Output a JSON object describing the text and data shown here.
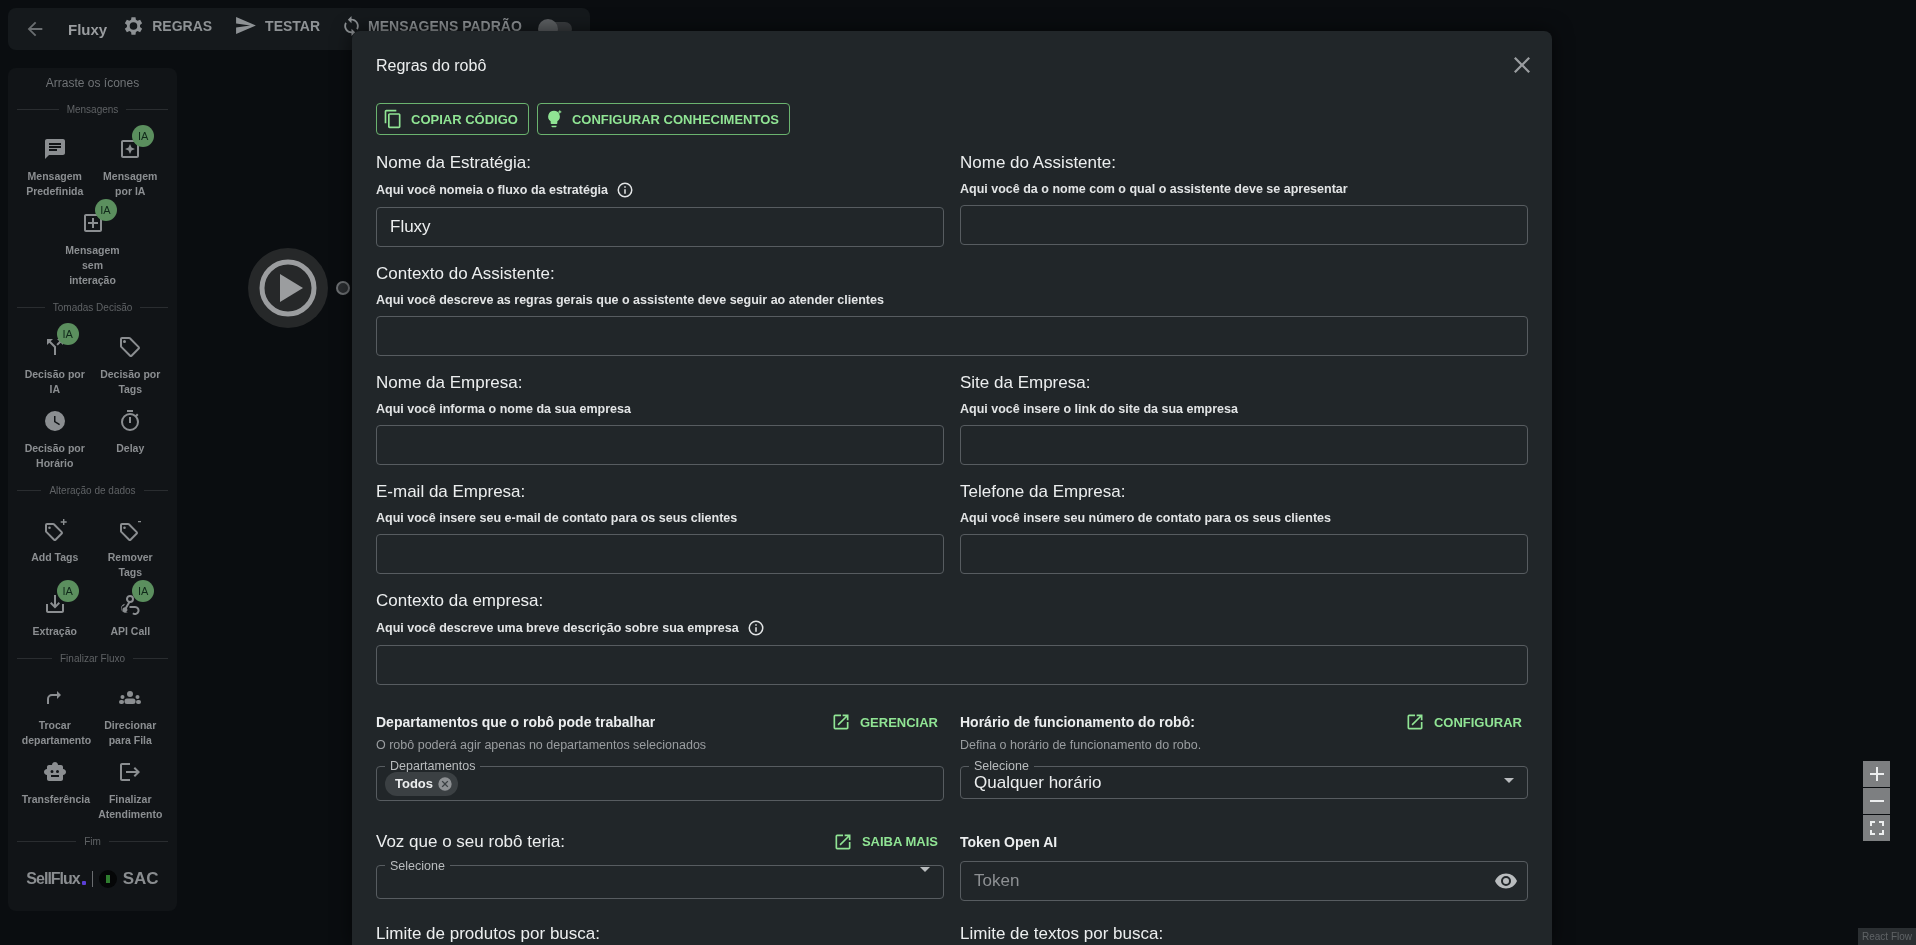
{
  "topbar": {
    "title": "Fluxy",
    "tabs": [
      {
        "label": "REGRAS"
      },
      {
        "label": "TESTAR"
      },
      {
        "label": "MENSAGENS PADRÃO"
      }
    ],
    "toggle": {
      "on": false
    }
  },
  "palette": {
    "title": "Arraste os ícones",
    "sections": [
      {
        "title": "Mensagens",
        "items": [
          {
            "label": "Mensagem Predefinida"
          },
          {
            "label": "Mensagem por IA",
            "badge": "IA"
          },
          {
            "label": "Mensagem sem interação",
            "badge": "IA"
          }
        ]
      },
      {
        "title": "Tomadas Decisão",
        "items": [
          {
            "label": "Decisão por IA",
            "badge": "IA"
          },
          {
            "label": "Decisão por Tags"
          },
          {
            "label": "Decisão por Horário"
          },
          {
            "label": "Delay"
          }
        ]
      },
      {
        "title": "Alteração de dados",
        "items": [
          {
            "label": "Add Tags"
          },
          {
            "label": "Remover Tags"
          },
          {
            "label": "Extração",
            "badge": "IA"
          },
          {
            "label": "API Call",
            "badge": "IA"
          }
        ]
      },
      {
        "title": "Finalizar Fluxo",
        "items": [
          {
            "label": "Trocar departamento"
          },
          {
            "label": "Direcionar para Fila"
          },
          {
            "label": "Transferência"
          },
          {
            "label": "Finalizar Atendimento"
          }
        ]
      },
      {
        "title": "Fim"
      }
    ],
    "logo": {
      "brand": "SellFlux",
      "product": "SAC"
    }
  },
  "canvas": {
    "attribution": "React Flow"
  },
  "dialog": {
    "title": "Regras do robô",
    "actions": [
      {
        "label": "COPIAR CÓDIGO"
      },
      {
        "label": "CONFIGURAR CONHECIMENTOS"
      }
    ],
    "rows": [
      [
        {
          "kind": "text",
          "label": "Nome da Estratégia:",
          "help": "Aqui você nomeia o fluxo da estratégia",
          "info": true,
          "value": "Fluxy"
        },
        {
          "kind": "text",
          "label": "Nome do Assistente:",
          "help": "Aqui você da o nome com o qual o assistente deve se apresentar",
          "info": false
        }
      ],
      [
        {
          "kind": "text",
          "label": "Contexto do Assistente:",
          "help": "Aqui você descreve as regras gerais que o assistente deve seguir ao atender clientes",
          "info": false
        }
      ],
      [
        {
          "kind": "text",
          "label": "Nome da Empresa:",
          "help": "Aqui você informa o nome da sua empresa",
          "info": false
        },
        {
          "kind": "text",
          "label": "Site da Empresa:",
          "help": "Aqui você insere o link do site da sua empresa",
          "info": false
        }
      ],
      [
        {
          "kind": "text",
          "label": "E-mail da Empresa:",
          "help": "Aqui você insere seu e-mail de contato para os seus clientes",
          "info": false
        },
        {
          "kind": "text",
          "label": "Telefone da Empresa:",
          "help": "Aqui você insere seu número de contato para os seus clientes",
          "info": false
        }
      ],
      [
        {
          "kind": "text",
          "label": "Contexto da empresa:",
          "help": "Aqui você descreve uma breve descrição sobre sua empresa",
          "info": true
        }
      ],
      [
        {
          "kind": "chips",
          "label": "Departamentos que o robô pode trabalhar",
          "strong": true,
          "link": "GERENCIAR",
          "help": "O robô poderá agir apenas no departamentos selecionados",
          "floating_label": "Departamentos",
          "chips": [
            "Todos"
          ]
        },
        {
          "kind": "select",
          "label": "Horário de funcionamento do robô:",
          "strong": true,
          "link": "CONFIGURAR",
          "help": "Defina o horário de funcionamento do robo.",
          "floating_label": "Selecione",
          "value": "Qualquer horário"
        }
      ],
      [
        {
          "kind": "select",
          "label": "Voz que o seu robô teria:",
          "strong": false,
          "link": "SAIBA MAIS",
          "floating_label": "Selecione"
        },
        {
          "kind": "secret",
          "label": "Token Open AI",
          "strong": true,
          "placeholder": "Token"
        }
      ],
      [
        {
          "kind": "heading",
          "label": "Limite de produtos por busca:",
          "strong": false
        },
        {
          "kind": "heading",
          "label": "Limite de textos por busca:",
          "strong": false
        }
      ]
    ]
  }
}
